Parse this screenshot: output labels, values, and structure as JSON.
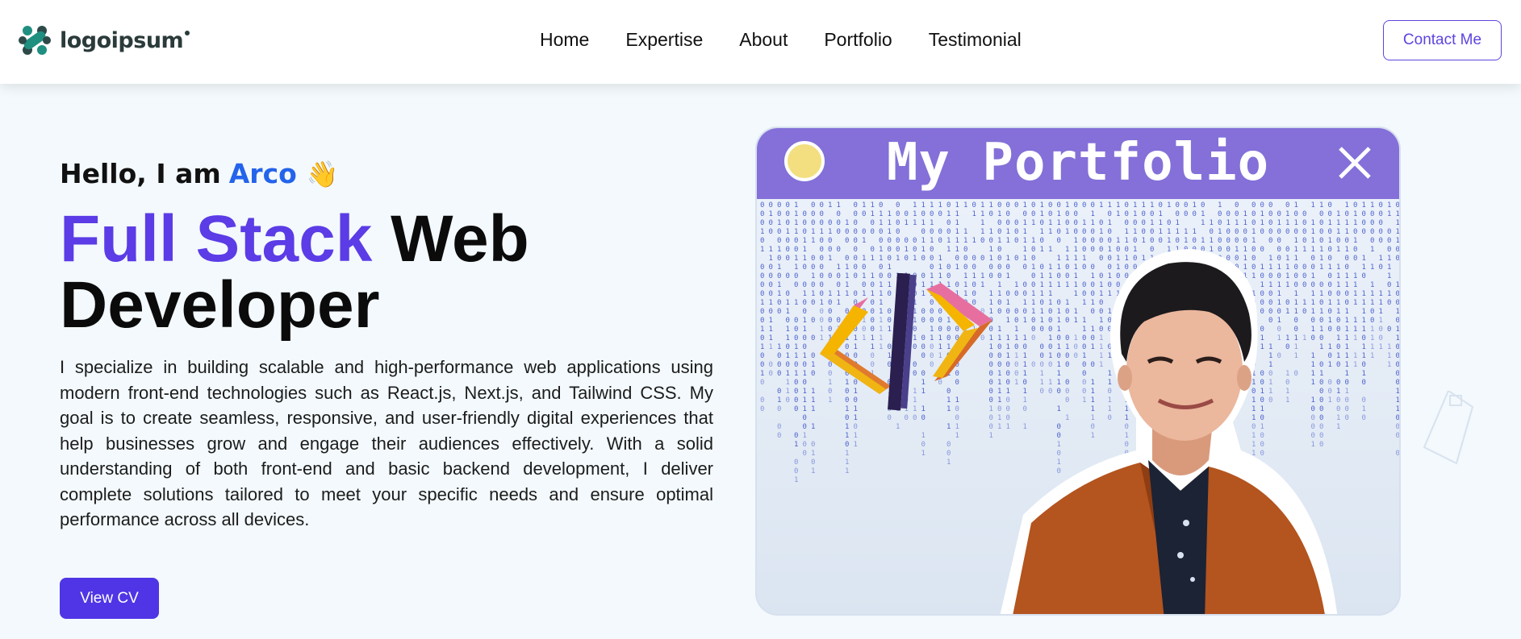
{
  "navbar": {
    "logo_text": "logoipsum",
    "logo_icon": "logo-mark-icon",
    "links": [
      "Home",
      "Expertise",
      "About",
      "Portfolio",
      "Testimonial"
    ],
    "contact_label": "Contact Me"
  },
  "hero": {
    "greeting_prefix": "Hello, I am",
    "name": "Arco",
    "wave_emoji": "👋",
    "headline_accent": "Full Stack",
    "headline_rest_1": "Web",
    "headline_line2": "Developer",
    "description": "I specialize in building scalable and high-performance web applications using modern front-end technologies such as React.js, Next.js, and Tailwind CSS. My goal is to create seamless, responsive, and user-friendly digital experiences that help businesses grow and engage their audiences effectively. With a solid understanding of both front-end and basic backend development, I deliver complete solutions tailored to meet your specific needs and ensure optimal performance across all devices.",
    "cta_label": "View CV"
  },
  "portfolio_card": {
    "title": "My Portfolio",
    "close_icon": "close-icon",
    "code_icon": "code-brackets-icon"
  },
  "colors": {
    "accent": "#5b3ce6",
    "name": "#2463eb",
    "button": "#4f35e5",
    "card_bar": "#8470d8",
    "background": "#f3f9fc"
  }
}
